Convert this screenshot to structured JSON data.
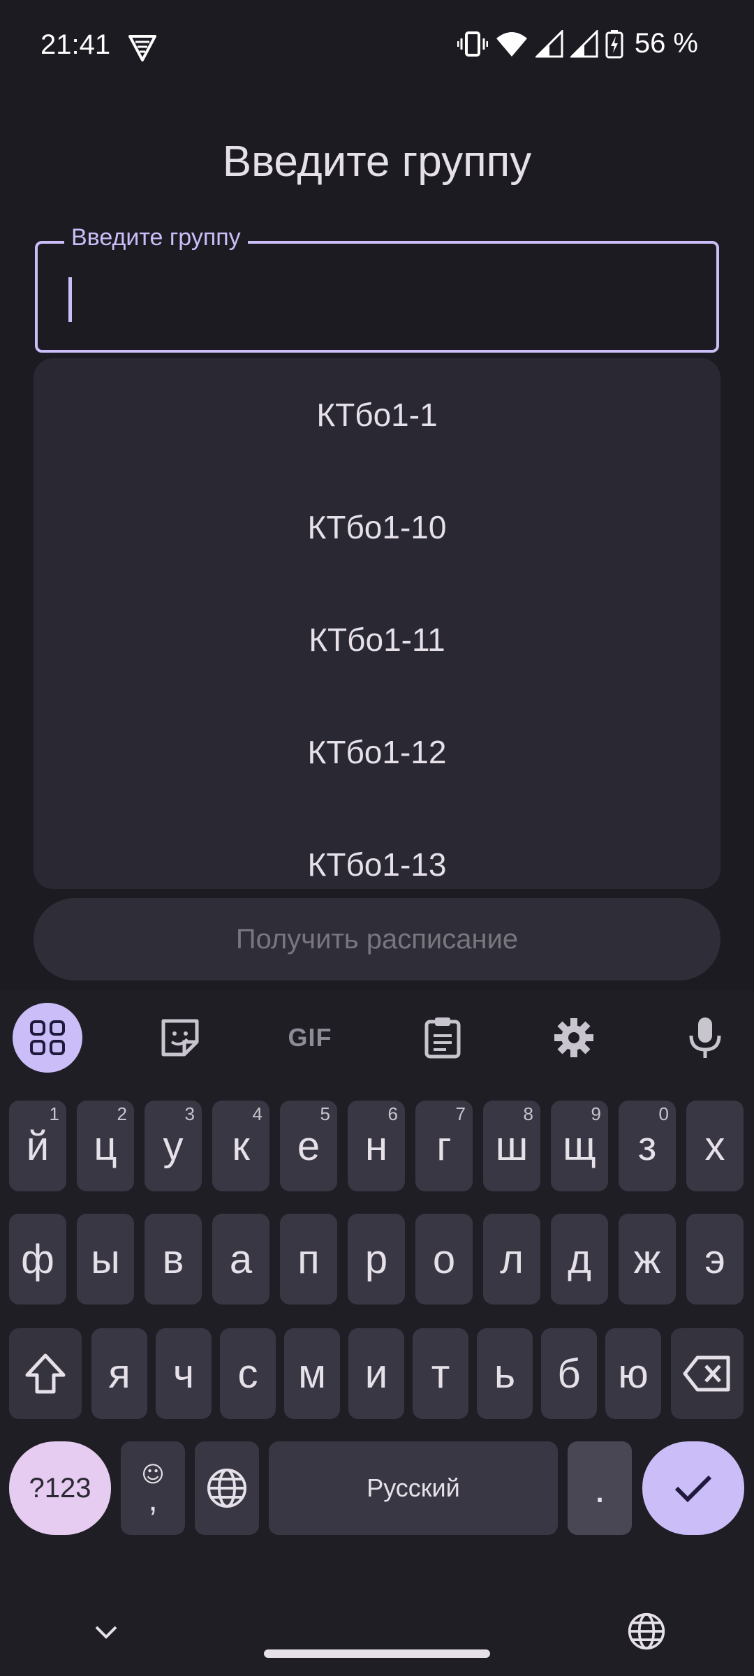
{
  "status_bar": {
    "time": "21:41",
    "battery": "56 %"
  },
  "page": {
    "title": "Введите группу"
  },
  "group_field": {
    "label": "Введите группу",
    "value": ""
  },
  "dropdown": {
    "items": [
      "КТбо1-1",
      "КТбо1-10",
      "КТбо1-11",
      "КТбо1-12",
      "КТбо1-13"
    ]
  },
  "action_button": {
    "label": "Получить расписание"
  },
  "keyboard": {
    "toolbar": [
      "apps-icon",
      "sticker-icon",
      "gif-icon",
      "clipboard-icon",
      "settings-icon",
      "microphone-icon"
    ],
    "gif_label": "GIF",
    "row1": [
      {
        "k": "й",
        "h": "1"
      },
      {
        "k": "ц",
        "h": "2"
      },
      {
        "k": "у",
        "h": "3"
      },
      {
        "k": "к",
        "h": "4"
      },
      {
        "k": "е",
        "h": "5"
      },
      {
        "k": "н",
        "h": "6"
      },
      {
        "k": "г",
        "h": "7"
      },
      {
        "k": "ш",
        "h": "8"
      },
      {
        "k": "щ",
        "h": "9"
      },
      {
        "k": "з",
        "h": "0"
      },
      {
        "k": "х",
        "h": ""
      }
    ],
    "row2": [
      "ф",
      "ы",
      "в",
      "а",
      "п",
      "р",
      "о",
      "л",
      "д",
      "ж",
      "э"
    ],
    "row3": [
      "я",
      "ч",
      "с",
      "м",
      "и",
      "т",
      "ь",
      "б",
      "ю"
    ],
    "num_label": "?123",
    "comma_label": ",",
    "space_label": "Русский",
    "period_label": ".",
    "accent": "#cbbef8"
  }
}
